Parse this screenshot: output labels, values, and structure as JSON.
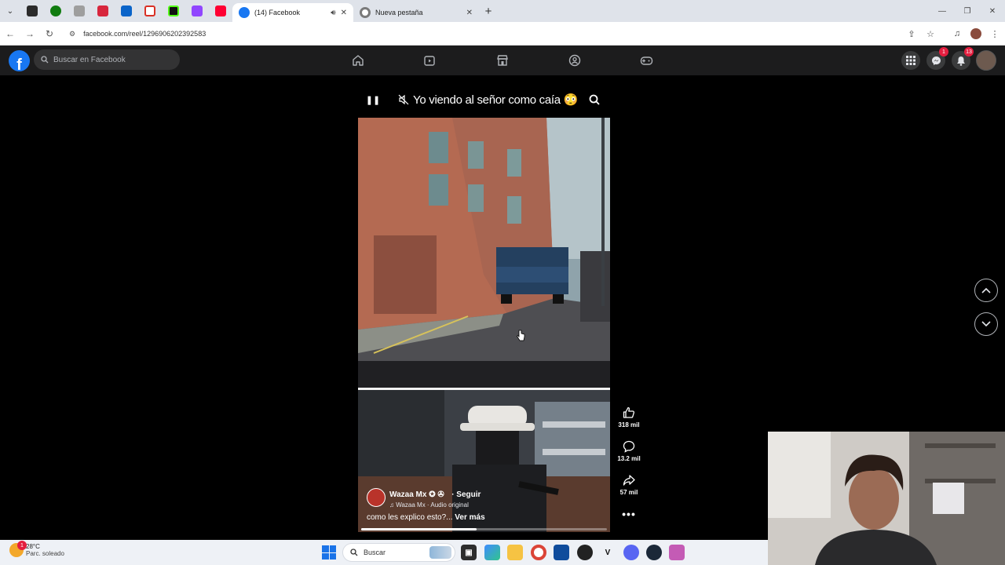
{
  "browser": {
    "tabs": [
      {
        "title": "(14) Facebook",
        "active": true
      },
      {
        "title": "Nueva pestaña",
        "active": false
      }
    ],
    "pinned_icons": [
      "app-icon",
      "xbox-icon",
      "docs-icon",
      "roblox-icon",
      "outlook-icon",
      "gmail-icon",
      "kick-icon",
      "twitch-icon",
      "youtube-icon"
    ],
    "url": "facebook.com/reel/1296906202392583"
  },
  "facebook": {
    "search_placeholder": "Buscar en Facebook",
    "nav_icons": [
      "home-icon",
      "video-icon",
      "marketplace-icon",
      "groups-icon",
      "gaming-icon"
    ],
    "messenger_badge": "1",
    "notifications_badge": "13"
  },
  "reel": {
    "top_caption": "Yo viendo al señor como caía 😳",
    "author_name": "Wazaa Mx ✪ ✇",
    "follow_label": "· Seguir",
    "audio_label": "♫ Wazaa Mx · Audio original",
    "description": "como les explico esto?...",
    "see_more": "Ver más",
    "progress": 0.47,
    "likes": "318 mil",
    "comments": "13.2 mil",
    "shares": "57 mil"
  },
  "taskbar": {
    "temperature": "28°C",
    "weather": "Parc. soleado",
    "search_label": "Buscar",
    "weather_badge": "1"
  },
  "colors": {
    "facebook_blue": "#1877f2",
    "header_bg": "#1c1c1d",
    "badge_red": "#e41e3f"
  }
}
